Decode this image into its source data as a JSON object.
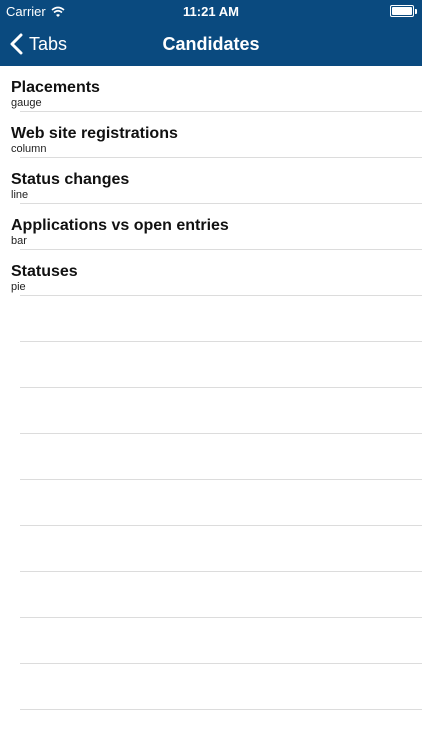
{
  "status_bar": {
    "carrier": "Carrier",
    "time": "11:21 AM",
    "battery_level": 1.0
  },
  "nav": {
    "back_label": "Tabs",
    "title": "Candidates"
  },
  "items": [
    {
      "title": "Placements",
      "subtitle": "gauge"
    },
    {
      "title": "Web site registrations",
      "subtitle": "column"
    },
    {
      "title": "Status changes",
      "subtitle": "line"
    },
    {
      "title": "Applications vs open entries",
      "subtitle": "bar"
    },
    {
      "title": "Statuses",
      "subtitle": "pie"
    }
  ],
  "colors": {
    "nav_background": "#0a4a7f",
    "separator": "#dcdcdc"
  }
}
